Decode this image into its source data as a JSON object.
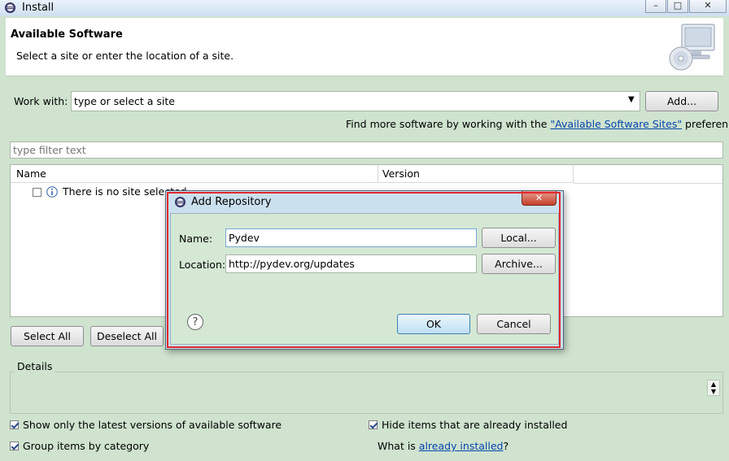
{
  "window": {
    "title": "Install",
    "minimize": "–",
    "maximize": "□",
    "close": "✕"
  },
  "header": {
    "title": "Available Software",
    "subtitle": "Select a site or enter the location of a site."
  },
  "work_with": {
    "label": "Work with:",
    "value": "type or select a site",
    "add_button": "Add..."
  },
  "find_more": {
    "prefix": "Find more software by working with the ",
    "link": "\"Available Software Sites\"",
    "suffix": " preferences."
  },
  "filter": {
    "placeholder": "type filter text"
  },
  "table": {
    "columns": [
      "Name",
      "Version"
    ],
    "rows": [
      {
        "name": "There is no site selected.",
        "version": ""
      }
    ]
  },
  "buttons": {
    "select_all": "Select All",
    "deselect_all": "Deselect All"
  },
  "details": {
    "label": "Details"
  },
  "options": {
    "show_latest": {
      "label": "Show only the latest versions of available software",
      "checked": true
    },
    "group_by_category": {
      "label": "Group items by category",
      "checked": true
    },
    "hide_installed": {
      "label": "Hide items that are already installed",
      "checked": true
    },
    "what_is": {
      "prefix": "What is ",
      "link": "already installed",
      "suffix": "?"
    }
  },
  "dialog": {
    "title": "Add Repository",
    "close": "✕",
    "name_label": "Name:",
    "name_value": "Pydev",
    "location_label": "Location:",
    "location_value": "http://pydev.org/updates",
    "local_button": "Local...",
    "archive_button": "Archive...",
    "help": "?",
    "ok_button": "OK",
    "cancel_button": "Cancel"
  },
  "colors": {
    "window_bg": "#cfe3cf",
    "dialog_frame": "#cbe0ee",
    "highlight_border": "#e0282c",
    "link": "#0645ad"
  }
}
